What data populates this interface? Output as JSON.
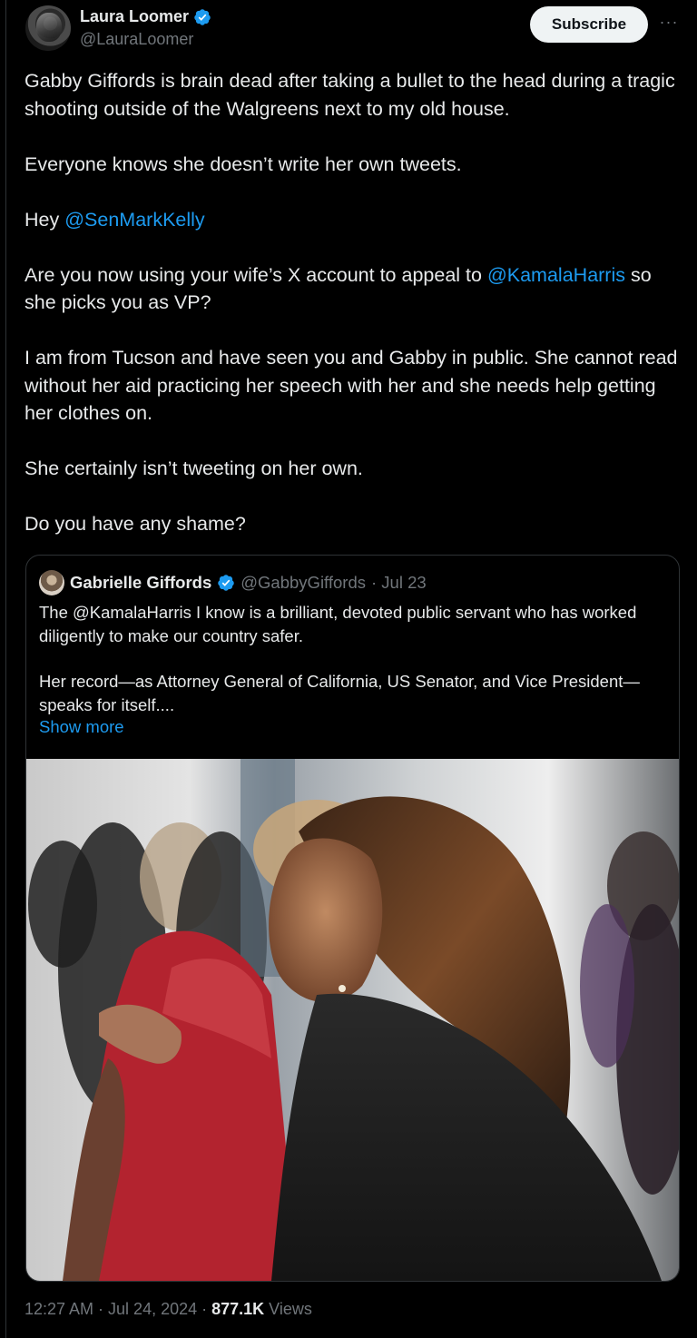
{
  "author": {
    "display_name": "Laura Loomer",
    "handle": "@LauraLoomer"
  },
  "subscribe_label": "Subscribe",
  "more_label": "···",
  "tweet": {
    "p1": "Gabby Giffords is brain dead after taking a bullet to the head during a tragic shooting outside of the Walgreens next to my old house.",
    "p2": "Everyone knows she doesn’t write her own tweets.",
    "p3_pre": "Hey ",
    "p3_mention": "@SenMarkKelly",
    "p4_pre": "Are you now using your wife’s X account to appeal to ",
    "p4_mention": "@KamalaHarris",
    "p4_post": " so she picks you as VP?",
    "p5": "I am from Tucson and have seen you and Gabby in public. She cannot read without her aid practicing her speech with her and she needs help getting her clothes on.",
    "p6": "She certainly isn’t tweeting on her own.",
    "p7": "Do you have any shame?"
  },
  "quote": {
    "display_name": "Gabrielle Giffords",
    "handle": "@GabbyGiffords",
    "date": "· Jul 23",
    "p1": "The @KamalaHarris I know is a brilliant, devoted public servant who has worked diligently to make our country safer.",
    "p2": "Her record—as Attorney General of California, US Senator, and Vice President—speaks for itself....",
    "show_more": "Show more"
  },
  "footer": {
    "time_date": "12:27 AM · Jul 24, 2024 · ",
    "views_count": "877.1K",
    "views_label": " Views"
  },
  "colors": {
    "background": "#000000",
    "text": "#e7e9ea",
    "secondary": "#71767b",
    "link": "#1d9bf0",
    "border": "#2f3336"
  }
}
